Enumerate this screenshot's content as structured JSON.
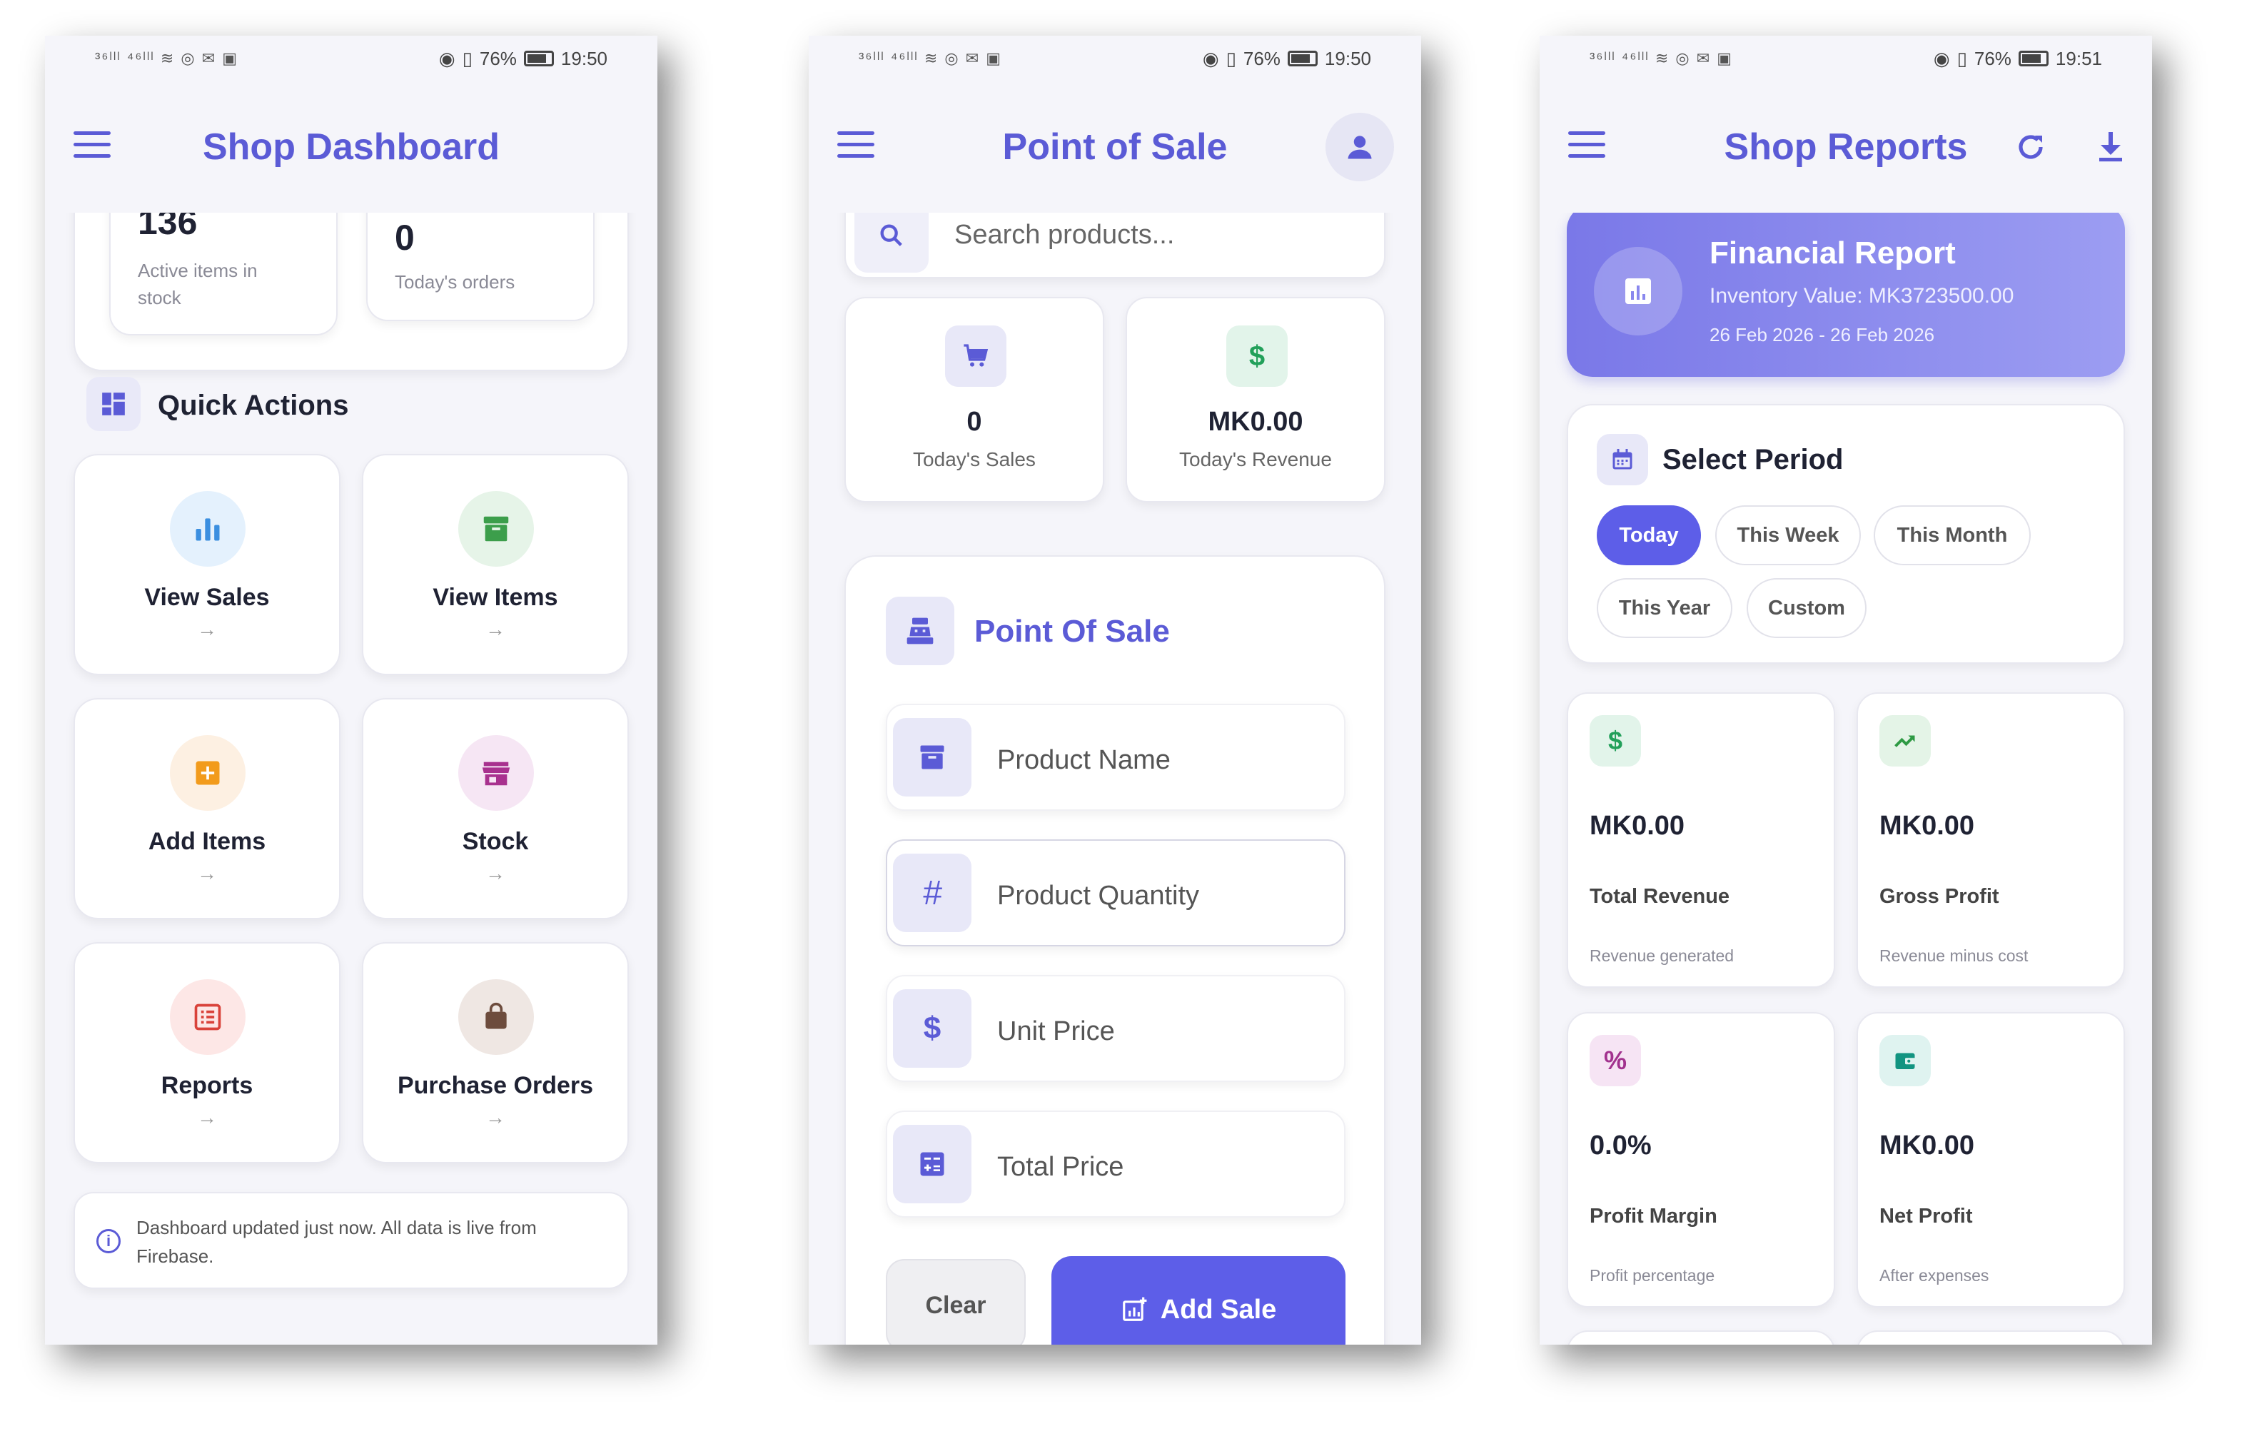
{
  "status_bar": {
    "p1": {
      "left": "³⁶ˡˡˡ ⁴⁶ˡˡˡ ≋ ◎ ✉ ▣",
      "battery": "76%",
      "time": "19:50"
    },
    "p2": {
      "left": "³⁶ˡˡˡ ⁴⁶ˡˡˡ ≋ ◎ ✉ ▣",
      "battery": "76%",
      "time": "19:50"
    },
    "p3": {
      "left": "³⁶ˡˡˡ ⁴⁶ˡˡˡ ≋ ◎ ✉ ▣",
      "battery": "76%",
      "time": "19:51"
    }
  },
  "dashboard": {
    "title": "Shop Dashboard",
    "stats": [
      {
        "value": "136",
        "label": "Active items in stock"
      },
      {
        "value": "0",
        "label": "Today's orders"
      }
    ],
    "quick_actions_title": "Quick Actions",
    "actions": [
      {
        "label": "View Sales",
        "icon": "bar-chart-icon",
        "arrow": "→"
      },
      {
        "label": "View Items",
        "icon": "archive-icon",
        "arrow": "→"
      },
      {
        "label": "Add Items",
        "icon": "add-box-icon",
        "arrow": "→"
      },
      {
        "label": "Stock",
        "icon": "store-icon",
        "arrow": "→"
      },
      {
        "label": "Reports",
        "icon": "list-report-icon",
        "arrow": "→"
      },
      {
        "label": "Purchase Orders",
        "icon": "shopping-bag-icon",
        "arrow": "→"
      }
    ],
    "footer_note": "Dashboard updated just now. All data is live from Firebase."
  },
  "pos": {
    "title": "Point of Sale",
    "search_placeholder": "Search products...",
    "stats": [
      {
        "value": "0",
        "label": "Today's Sales"
      },
      {
        "value": "MK0.00",
        "label": "Today's Revenue"
      }
    ],
    "form_title": "Point Of Sale",
    "fields": [
      {
        "placeholder": "Product Name",
        "icon": "archive-icon"
      },
      {
        "placeholder": "Product Quantity",
        "icon": "hash-icon"
      },
      {
        "placeholder": "Unit Price",
        "icon": "dollar-icon"
      },
      {
        "placeholder": "Total Price",
        "icon": "calculator-icon"
      }
    ],
    "clear_label": "Clear",
    "add_sale_label": "Add Sale"
  },
  "reports": {
    "title": "Shop Reports",
    "banner": {
      "title": "Financial Report",
      "inventory": "Inventory Value: MK3723500.00",
      "range": "26 Feb 2026 - 26 Feb 2026"
    },
    "period_title": "Select Period",
    "periods": [
      "Today",
      "This Week",
      "This Month",
      "This Year",
      "Custom"
    ],
    "selected_period": "Today",
    "metrics": [
      {
        "value": "MK0.00",
        "label": "Total Revenue",
        "sub": "Revenue generated",
        "icon": "dollar-icon"
      },
      {
        "value": "MK0.00",
        "label": "Gross Profit",
        "sub": "Revenue minus cost",
        "icon": "trending-up-icon"
      },
      {
        "value": "0.0%",
        "label": "Profit Margin",
        "sub": "Profit percentage",
        "icon": "percent-icon"
      },
      {
        "value": "MK0.00",
        "label": "Net Profit",
        "sub": "After expenses",
        "icon": "wallet-icon"
      }
    ]
  },
  "colors": {
    "accent": "#5b5bd6",
    "background": "#f5f5fa",
    "card": "#ffffff"
  }
}
